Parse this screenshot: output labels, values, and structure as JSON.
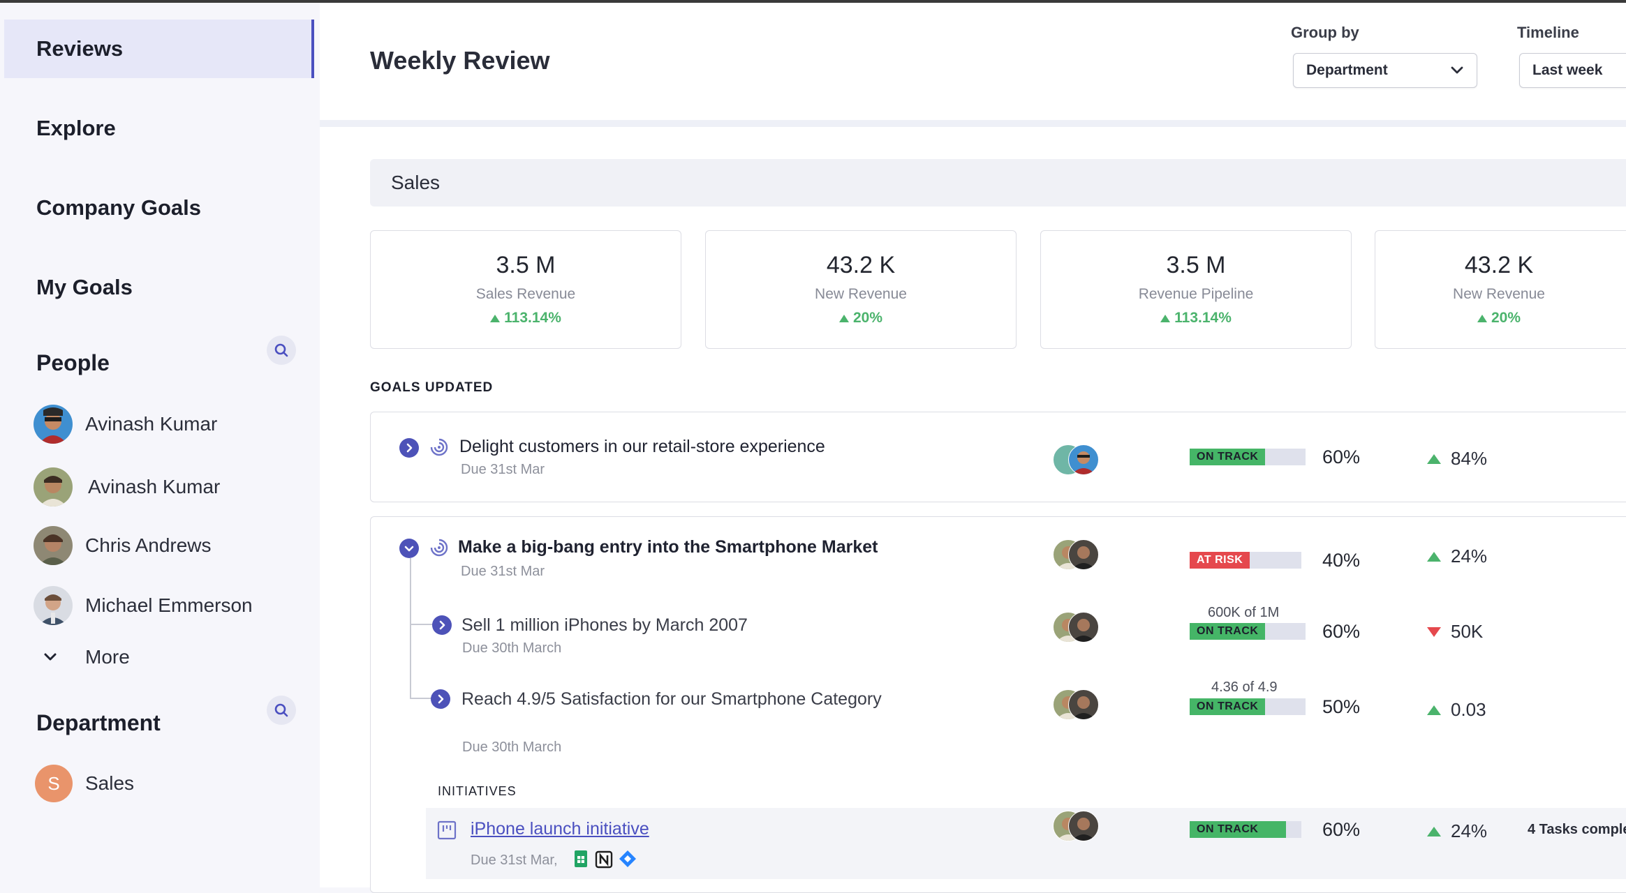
{
  "sidebar": {
    "nav": [
      "Reviews",
      "Explore",
      "Company Goals",
      "My Goals"
    ],
    "people_heading": "People",
    "people": [
      "Avinash Kumar",
      "Avinash Kumar",
      "Chris Andrews",
      "Michael Emmerson"
    ],
    "more_label": "More",
    "department_heading": "Department",
    "department": {
      "initial": "S",
      "name": "Sales"
    }
  },
  "header": {
    "title": "Weekly Review",
    "group_by": {
      "label": "Group by",
      "value": "Department"
    },
    "timeline": {
      "label": "Timeline",
      "value": "Last week"
    }
  },
  "section": {
    "title": "Sales"
  },
  "kpis": [
    {
      "value": "3.5 M",
      "label": "Sales Revenue",
      "delta": "113.14%"
    },
    {
      "value": "43.2 K",
      "label": "New Revenue",
      "delta": "20%"
    },
    {
      "value": "3.5 M",
      "label": "Revenue Pipeline",
      "delta": "113.14%"
    },
    {
      "value": "43.2 K",
      "label": "New Revenue",
      "delta": "20%"
    }
  ],
  "goals_heading": "GOALS UPDATED",
  "goals": [
    {
      "title": "Delight customers in our retail-store experience",
      "due": "Due 31st Mar",
      "status": "ON TRACK",
      "progress": 0.6,
      "percent": "60%",
      "delta": "84%",
      "delta_dir": "up"
    },
    {
      "title": "Make a big-bang entry into the Smartphone Market",
      "due": "Due 31st Mar",
      "status": "AT RISK",
      "progress": 0.4,
      "percent": "40%",
      "delta": "24%",
      "delta_dir": "up",
      "children": [
        {
          "title": "Sell 1 million iPhones by March 2007",
          "due": "Due 30th March",
          "progress_text": "600K of 1M",
          "status": "ON TRACK",
          "progress": 0.6,
          "percent": "60%",
          "delta": "50K",
          "delta_dir": "down"
        },
        {
          "title": "Reach 4.9/5 Satisfaction for our Smartphone Category",
          "due": "Due 30th March",
          "progress_text": "4.36 of 4.9",
          "status": "ON TRACK",
          "progress": 0.5,
          "percent": "50%",
          "delta": "0.03",
          "delta_dir": "up"
        }
      ],
      "initiatives_label": "INITIATIVES",
      "initiative": {
        "title": "iPhone launch initiative",
        "due": "Due 31st Mar,",
        "status": "ON TRACK",
        "progress": 0.8,
        "percent": "60%",
        "delta": "24%",
        "delta_dir": "up",
        "tasks": "4 Tasks comple"
      }
    }
  ],
  "colors": {
    "accent": "#4a4fc0",
    "on_track": "#45b567",
    "at_risk": "#e5484d",
    "up": "#4bb36c",
    "down": "#e5484d"
  }
}
